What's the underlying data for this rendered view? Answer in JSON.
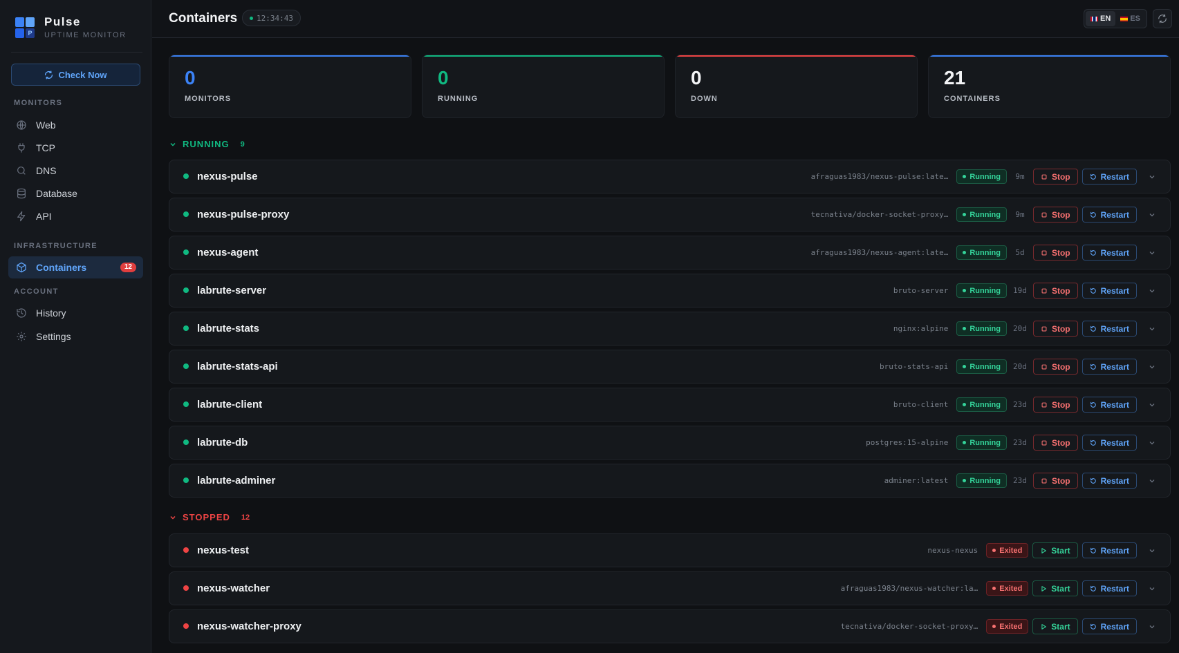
{
  "brand": {
    "name": "Pulse",
    "subtitle": "UPTIME MONITOR",
    "logo_letter": "P"
  },
  "sidebar": {
    "check_now": "Check Now",
    "sections": [
      {
        "title": "MONITORS",
        "items": [
          {
            "label": "Web",
            "icon": "globe-icon"
          },
          {
            "label": "TCP",
            "icon": "plug-icon"
          },
          {
            "label": "DNS",
            "icon": "search-icon"
          },
          {
            "label": "Database",
            "icon": "database-icon"
          },
          {
            "label": "API",
            "icon": "bolt-icon"
          }
        ]
      },
      {
        "title": "INFRASTRUCTURE",
        "items": [
          {
            "label": "Containers",
            "icon": "box-icon",
            "badge": "12",
            "active": true
          }
        ]
      },
      {
        "title": "ACCOUNT",
        "items": [
          {
            "label": "History",
            "icon": "history-icon"
          },
          {
            "label": "Settings",
            "icon": "gear-icon"
          }
        ]
      }
    ]
  },
  "header": {
    "title": "Containers",
    "time": "12:34:43",
    "lang_en": "EN",
    "lang_es": "ES"
  },
  "stats": [
    {
      "value": "0",
      "label": "MONITORS",
      "color": "#3b82f6"
    },
    {
      "value": "0",
      "label": "RUNNING",
      "color": "#10b981"
    },
    {
      "value": "0",
      "label": "DOWN",
      "color": "#ef4444"
    },
    {
      "value": "21",
      "label": "CONTAINERS",
      "color": "#3b82f6"
    }
  ],
  "colors": {
    "accent": "#3b82f6",
    "running": "#10b981",
    "stopped": "#ef4444"
  },
  "groups": [
    {
      "title": "RUNNING",
      "count": "9",
      "color": "#10b981",
      "containers": [
        {
          "name": "nexus-pulse",
          "image": "afraguas1983/nexus-pulse:late…",
          "status": "Running",
          "uptime": "9m",
          "action": "Stop",
          "restart": "Restart"
        },
        {
          "name": "nexus-pulse-proxy",
          "image": "tecnativa/docker-socket-proxy…",
          "status": "Running",
          "uptime": "9m",
          "action": "Stop",
          "restart": "Restart"
        },
        {
          "name": "nexus-agent",
          "image": "afraguas1983/nexus-agent:late…",
          "status": "Running",
          "uptime": "5d",
          "action": "Stop",
          "restart": "Restart"
        },
        {
          "name": "labrute-server",
          "image": "bruto-server",
          "status": "Running",
          "uptime": "19d",
          "action": "Stop",
          "restart": "Restart"
        },
        {
          "name": "labrute-stats",
          "image": "nginx:alpine",
          "status": "Running",
          "uptime": "20d",
          "action": "Stop",
          "restart": "Restart"
        },
        {
          "name": "labrute-stats-api",
          "image": "bruto-stats-api",
          "status": "Running",
          "uptime": "20d",
          "action": "Stop",
          "restart": "Restart"
        },
        {
          "name": "labrute-client",
          "image": "bruto-client",
          "status": "Running",
          "uptime": "23d",
          "action": "Stop",
          "restart": "Restart"
        },
        {
          "name": "labrute-db",
          "image": "postgres:15-alpine",
          "status": "Running",
          "uptime": "23d",
          "action": "Stop",
          "restart": "Restart"
        },
        {
          "name": "labrute-adminer",
          "image": "adminer:latest",
          "status": "Running",
          "uptime": "23d",
          "action": "Stop",
          "restart": "Restart"
        }
      ]
    },
    {
      "title": "STOPPED",
      "count": "12",
      "color": "#ef4444",
      "containers": [
        {
          "name": "nexus-test",
          "image": "nexus-nexus",
          "status": "Exited",
          "uptime": "",
          "action": "Start",
          "restart": "Restart"
        },
        {
          "name": "nexus-watcher",
          "image": "afraguas1983/nexus-watcher:la…",
          "status": "Exited",
          "uptime": "",
          "action": "Start",
          "restart": "Restart"
        },
        {
          "name": "nexus-watcher-proxy",
          "image": "tecnativa/docker-socket-proxy…",
          "status": "Exited",
          "uptime": "",
          "action": "Start",
          "restart": "Restart"
        }
      ]
    }
  ]
}
